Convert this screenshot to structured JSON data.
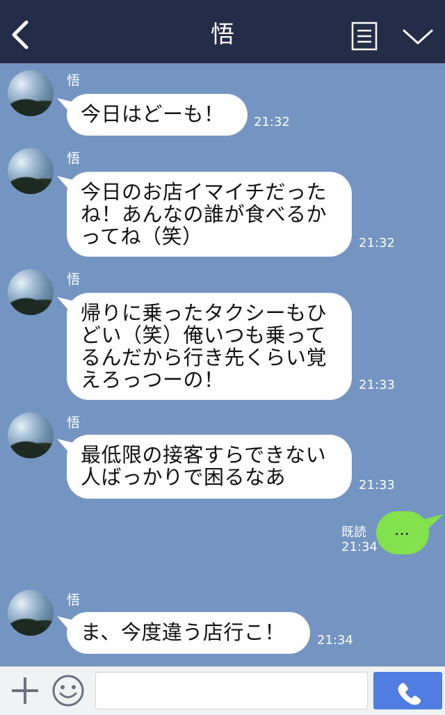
{
  "header": {
    "title": "悟",
    "back_icon": "back-chevron-icon",
    "menu_icon": "document-menu-icon",
    "dropdown_icon": "chevron-down-icon"
  },
  "messages": [
    {
      "sender": "悟",
      "text": "今日はどーも！",
      "time": "21:32"
    },
    {
      "sender": "悟",
      "lines": [
        "今日のお店イマイチだった",
        "ね！あんなの誰が食べるか",
        "ってね（笑）"
      ],
      "time": "21:32"
    },
    {
      "sender": "悟",
      "lines": [
        "帰りに乗ったタクシーもひ",
        "どい（笑）俺いつも乗って",
        "るんだから行き先くらい覚",
        "えろっつーの！"
      ],
      "time": "21:33"
    },
    {
      "sender": "悟",
      "lines": [
        "最低限の接客すらできない",
        "人ばっかりで困るなあ"
      ],
      "time": "21:33"
    },
    {
      "sender": "悟",
      "text": "ま、今度違う店行こ！",
      "time": "21:34"
    }
  ],
  "mine": {
    "text": "…",
    "read": "既読",
    "time": "21:34"
  },
  "footer": {
    "plus_icon": "plus-icon",
    "emoji_icon": "smiley-icon",
    "input_value": "",
    "call_icon": "phone-icon"
  },
  "colors": {
    "header_bg": "#232d47",
    "chat_bg": "#7494c2",
    "my_bubble": "#84e14e",
    "call_button": "#4f7ee0"
  }
}
